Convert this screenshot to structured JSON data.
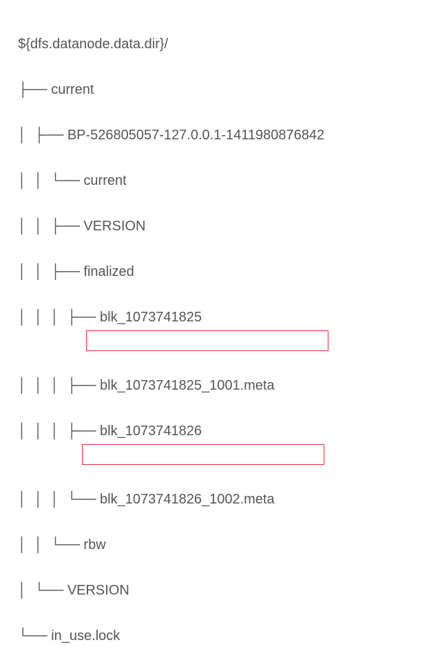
{
  "tree": {
    "rootVar": "${dfs.datanode.data.dir}/",
    "lines": [
      {
        "prefix": "├── ",
        "label": "current"
      },
      {
        "prefix": "│  ├── ",
        "label": "BP-526805057-127.0.0.1-1411980876842"
      },
      {
        "prefix": "│  │  └── ",
        "label": "current"
      },
      {
        "prefix": "│  │  ├── ",
        "label": "VERSION"
      },
      {
        "prefix": "│  │  ├── ",
        "label": "finalized"
      },
      {
        "prefix": "│  │  │  ├── ",
        "label": "blk_1073741825"
      },
      {
        "prefix": "│  │  │  ├── ",
        "label": "blk_1073741825_1001.meta",
        "boxed": 1
      },
      {
        "prefix": "│  │  │  ├── ",
        "label": "blk_1073741826"
      },
      {
        "prefix": "│  │  │  └── ",
        "label": "blk_1073741826_1002.meta",
        "boxed": 2
      },
      {
        "prefix": "│  │  └── ",
        "label": "rbw"
      },
      {
        "prefix": "│  └── ",
        "label": "VERSION"
      },
      {
        "prefix": "└── ",
        "label": "in_use.lock"
      }
    ]
  }
}
